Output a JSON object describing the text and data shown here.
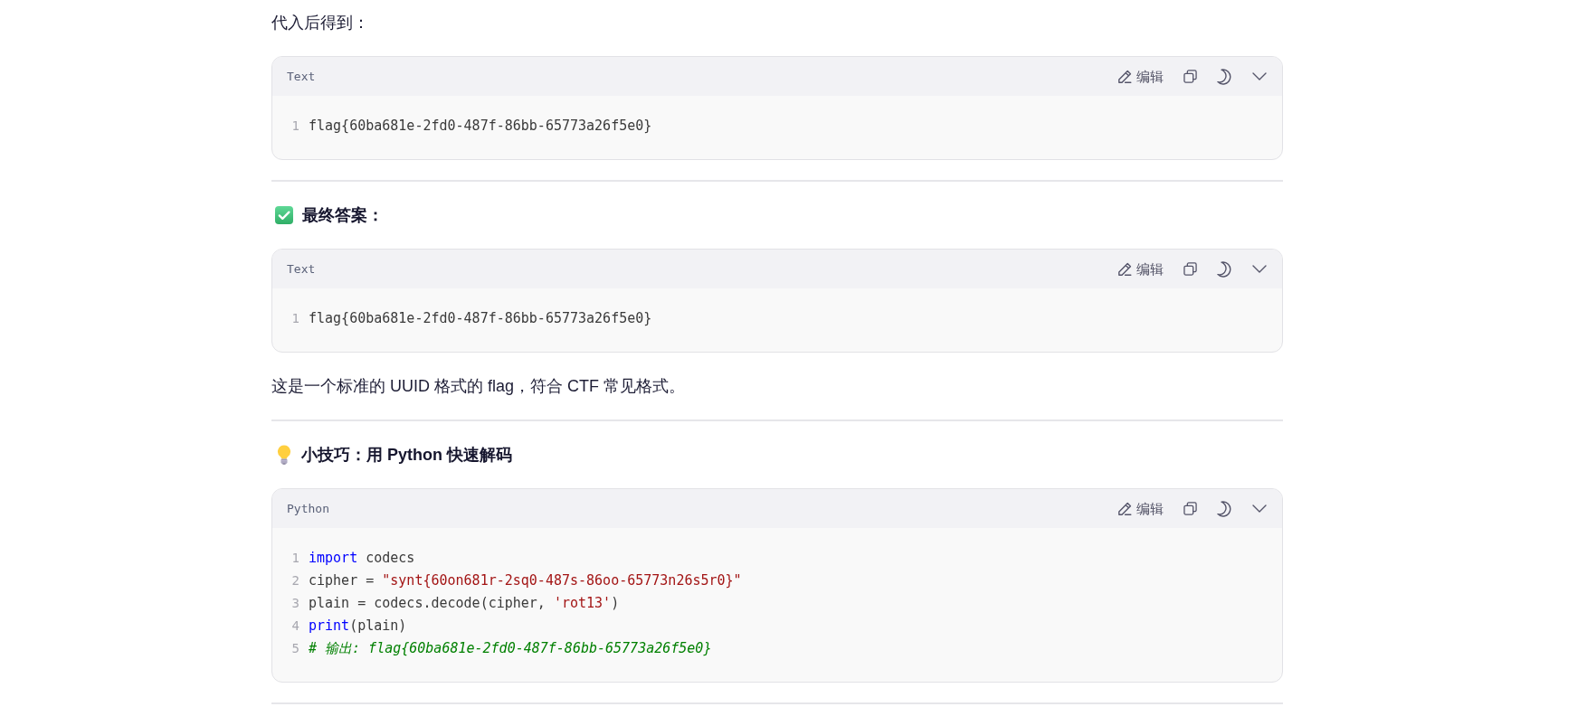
{
  "blocks": [
    {
      "kind": "paragraph",
      "text": "代入后得到："
    },
    {
      "kind": "code",
      "language": "Text",
      "edit_label": "编辑",
      "lines": [
        {
          "number": "1",
          "tokens": [
            {
              "kind": "plain",
              "text": "flag{60ba681e-2fd0-487f-86bb-65773a26f5e0}"
            }
          ]
        }
      ]
    },
    {
      "kind": "rule"
    },
    {
      "kind": "answer",
      "text": "最终答案："
    },
    {
      "kind": "code",
      "language": "Text",
      "edit_label": "编辑",
      "lines": [
        {
          "number": "1",
          "tokens": [
            {
              "kind": "plain",
              "text": "flag{60ba681e-2fd0-487f-86bb-65773a26f5e0}"
            }
          ]
        }
      ]
    },
    {
      "kind": "paragraph",
      "text": "这是一个标准的 UUID 格式的 flag，符合 CTF 常见格式。"
    },
    {
      "kind": "rule"
    },
    {
      "kind": "tip",
      "text": "小技巧：用 Python 快速解码"
    },
    {
      "kind": "code",
      "language": "Python",
      "edit_label": "编辑",
      "lines": [
        {
          "number": "1",
          "tokens": [
            {
              "kind": "keyword",
              "text": "import"
            },
            {
              "kind": "plain",
              "text": " codecs"
            }
          ]
        },
        {
          "number": "2",
          "tokens": [
            {
              "kind": "plain",
              "text": "cipher = "
            },
            {
              "kind": "string",
              "text": "\"synt{60on681r-2sq0-487s-86oo-65773n26s5r0}\""
            }
          ]
        },
        {
          "number": "3",
          "tokens": [
            {
              "kind": "plain",
              "text": "plain = codecs.decode(cipher, "
            },
            {
              "kind": "string",
              "text": "'rot13'"
            },
            {
              "kind": "plain",
              "text": ")"
            }
          ]
        },
        {
          "number": "4",
          "tokens": [
            {
              "kind": "keyword",
              "text": "print"
            },
            {
              "kind": "plain",
              "text": "(plain)"
            }
          ]
        },
        {
          "number": "5",
          "tokens": [
            {
              "kind": "comment",
              "text": "# 输出: flag{60ba681e-2fd0-487f-86bb-65773a26f5e0}"
            }
          ]
        }
      ]
    },
    {
      "kind": "rule"
    }
  ]
}
